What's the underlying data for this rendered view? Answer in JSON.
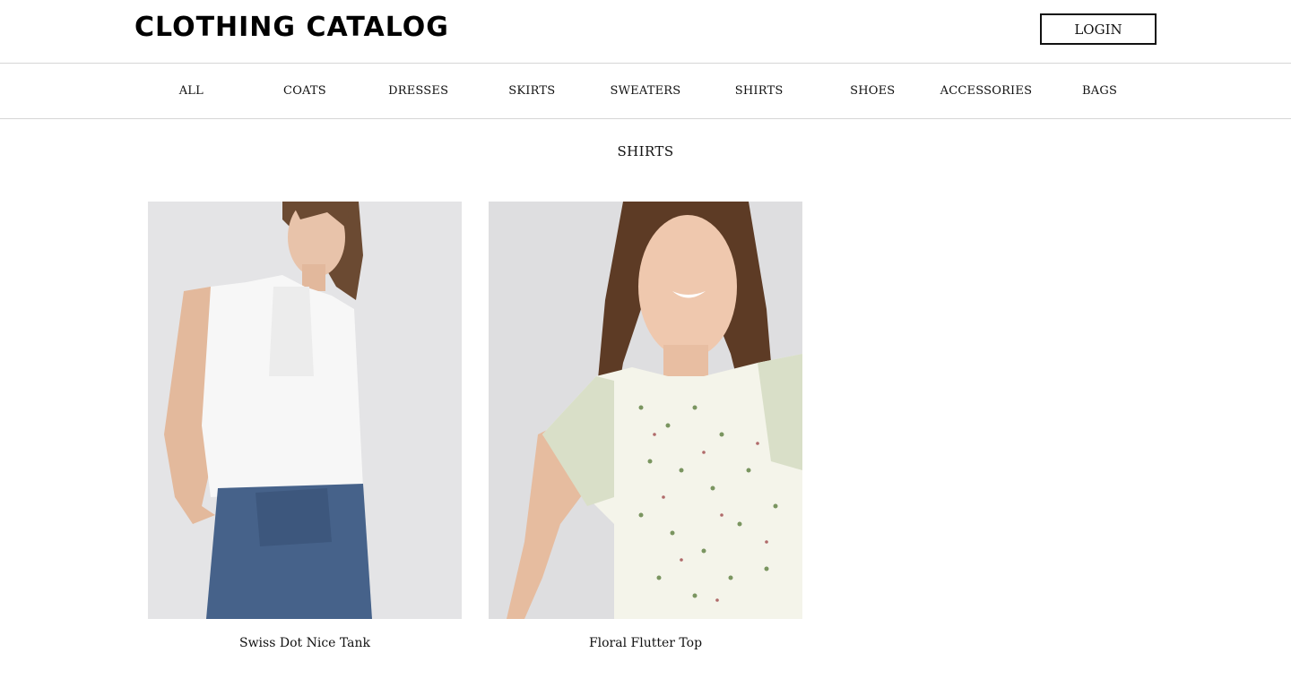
{
  "header": {
    "logo_text": "CLOTHING CATALOG",
    "login_label": "LOGIN"
  },
  "nav": {
    "items": [
      {
        "label": "ALL"
      },
      {
        "label": "COATS"
      },
      {
        "label": "DRESSES"
      },
      {
        "label": "SKIRTS"
      },
      {
        "label": "SWEATERS"
      },
      {
        "label": "SHIRTS"
      },
      {
        "label": "SHOES"
      },
      {
        "label": "ACCESSORIES"
      },
      {
        "label": "BAGS"
      }
    ]
  },
  "main": {
    "section_title": "SHIRTS",
    "products": [
      {
        "name": "Swiss Dot Nice Tank"
      },
      {
        "name": "Floral Flutter Top"
      }
    ]
  },
  "colors": {
    "text": "#111111",
    "border": "#d6d6d6",
    "image_bg": "#e5e5e7"
  }
}
